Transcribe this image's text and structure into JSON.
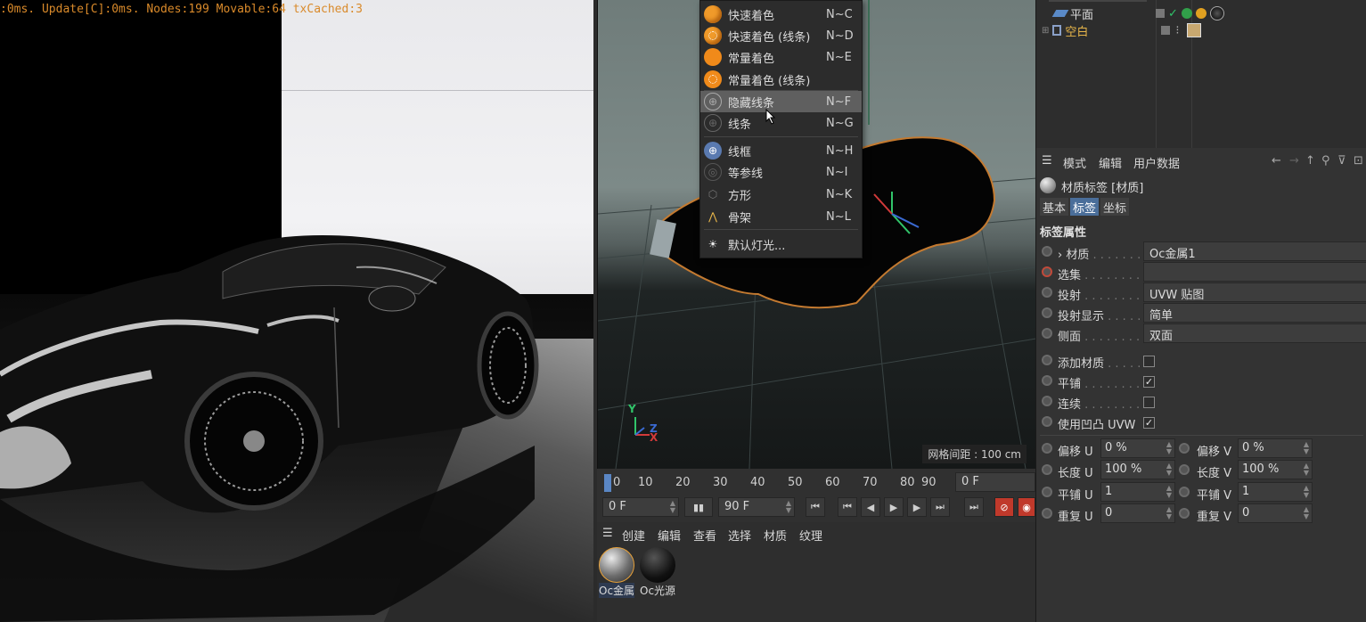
{
  "render": {
    "stats": ":0ms. Update[C]:0ms. Nodes:199 Movable:64 txCached:3"
  },
  "viewport": {
    "grid_spacing": "网格间距 : 100 cm",
    "axis_y": "Y",
    "axis_z": "Z",
    "axis_x": "X"
  },
  "menu": {
    "items": [
      {
        "label": "快速着色",
        "key": "N~C",
        "icon": "sphere-icon"
      },
      {
        "label": "快速着色 (线条)",
        "key": "N~D",
        "icon": "sphere-wire-icon"
      },
      {
        "label": "常量着色",
        "key": "N~E",
        "icon": "flat-sphere-icon"
      },
      {
        "label": "常量着色 (线条)",
        "key": "",
        "icon": "flat-sphere-wire-icon"
      },
      {
        "label": "隐藏线条",
        "key": "N~F",
        "icon": "hidden-line-icon"
      },
      {
        "label": "线条",
        "key": "N~G",
        "icon": "lines-icon"
      },
      {
        "label": "线框",
        "key": "N~H",
        "icon": "wireframe-icon"
      },
      {
        "label": "等参线",
        "key": "N~I",
        "icon": "isoparm-icon"
      },
      {
        "label": "方形",
        "key": "N~K",
        "icon": "box-icon"
      },
      {
        "label": "骨架",
        "key": "N~L",
        "icon": "skeleton-icon"
      },
      {
        "label": "默认灯光...",
        "key": "",
        "icon": "default-light-icon"
      }
    ]
  },
  "timeline": {
    "ticks": [
      "0",
      "10",
      "20",
      "30",
      "40",
      "50",
      "60",
      "70",
      "80",
      "90"
    ],
    "current_frame": "0 F",
    "start_frame": "0 F",
    "end_frame": "90 F"
  },
  "material_manager": {
    "menu": [
      "创建",
      "编辑",
      "查看",
      "选择",
      "材质",
      "纹理"
    ],
    "materials": [
      {
        "name": "Oc金属"
      },
      {
        "name": "Oc光源"
      }
    ]
  },
  "object_manager": {
    "rows": [
      {
        "name": "平面",
        "color": "#dcdcdc"
      },
      {
        "name": "空白",
        "color": "#e8b64a"
      }
    ]
  },
  "attribute_manager": {
    "menu": [
      "模式",
      "编辑",
      "用户数据"
    ],
    "title": "材质标签 [材质]",
    "tabs": [
      "基本",
      "标签",
      "坐标"
    ],
    "active_tab": "标签",
    "section": "标签属性",
    "props": [
      {
        "label": "› 材质",
        "value": "Oc金属1"
      },
      {
        "label": "选集",
        "value": ""
      },
      {
        "label": "投射",
        "value": "UVW 贴图"
      },
      {
        "label": "投射显示",
        "value": "简单"
      },
      {
        "label": "侧面",
        "value": "双面"
      }
    ],
    "checks": [
      {
        "label": "添加材质",
        "checked": false
      },
      {
        "label": "平铺",
        "checked": true
      },
      {
        "label": "连续",
        "checked": false
      },
      {
        "label": "使用凹凸 UVW",
        "checked": true
      }
    ],
    "pairs": [
      {
        "left_label": "偏移 U",
        "left_value": "0 %",
        "right_label": "偏移 V",
        "right_value": "0 %"
      },
      {
        "left_label": "长度 U",
        "left_value": "100 %",
        "right_label": "长度 V",
        "right_value": "100 %"
      },
      {
        "left_label": "平铺 U",
        "left_value": "1",
        "right_label": "平铺 V",
        "right_value": "1"
      },
      {
        "left_label": "重复 U",
        "left_value": "0",
        "right_label": "重复 V",
        "right_value": "0"
      }
    ]
  }
}
